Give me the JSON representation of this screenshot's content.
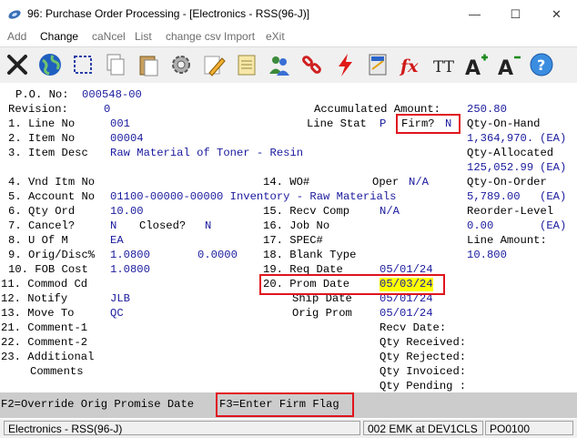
{
  "window": {
    "title": "96: Purchase Order Processing - [Electronics - RSS(96-J)]",
    "minimize_glyph": "—",
    "maximize_glyph": "☐",
    "close_glyph": "✕"
  },
  "menu": [
    {
      "label": "Add"
    },
    {
      "label": "Change"
    },
    {
      "label": "caNcel"
    },
    {
      "label": "List"
    },
    {
      "label": "change csv Import"
    },
    {
      "label": "eXit"
    }
  ],
  "toolbar_icons": [
    "close-x-icon",
    "globe-icon",
    "select-rectangle-icon",
    "copy-icon",
    "paste-icon",
    "settings-icon",
    "edit-pencil-icon",
    "notes-icon",
    "users-icon",
    "link-icon",
    "lightning-icon",
    "calculator-icon",
    "function-icon",
    "font-size-icon",
    "increase-font-icon",
    "decrease-font-icon",
    "help-icon"
  ],
  "toolbar_text": {
    "fx": "fx",
    "tt": "TT",
    "aplus": "A",
    "aminus": "A",
    "help": "?"
  },
  "form": {
    "po_no_label": "P.O. No:",
    "po_no": "000548-00",
    "revision_label": "Revision:",
    "revision": "0",
    "accum_label": "Accumulated Amount:",
    "accum": "250.80",
    "f1_label": "1. Line No",
    "f1": "001",
    "line_stat_label": "Line Stat",
    "line_stat": "P",
    "firm_label": "Firm?",
    "firm": "N",
    "qoh_label": "Qty-On-Hand",
    "qoh": "1,364,970.",
    "qoh_unit": "(EA)",
    "f2_label": "2. Item No",
    "f2": "00004",
    "f3_label": "3. Item Desc",
    "f3": "Raw Material of Toner - Resin",
    "qalloc_label": "Qty-Allocated",
    "qalloc": "125,052.99",
    "qalloc_unit": "(EA)",
    "f4_label": "4. Vnd Itm No",
    "f14_label": "14. WO#",
    "oper_label": "Oper",
    "oper": "N/A",
    "qoo_label": "Qty-On-Order",
    "qoo": "5,789.00",
    "qoo_unit": "(EA)",
    "f5_label": "5. Account No",
    "f5": "01100-00000-00000 Inventory - Raw Materials",
    "f6_label": "6. Qty Ord",
    "f6": "10.00",
    "f15_label": "15. Recv Comp",
    "f15": "N/A",
    "reorder_label": "Reorder-Level",
    "f7_label": "7. Cancel?",
    "f7": "N",
    "closed_label": "Closed?",
    "closed": "N",
    "f16_label": "16. Job No",
    "reorder": "0.00",
    "reorder_unit": "(EA)",
    "f8_label": "8. U Of M",
    "f8": "EA",
    "f17_label": "17. SPEC#",
    "line_amt_label": "Line Amount:",
    "f9_label": "9. Orig/Disc%",
    "f9": "1.0800",
    "f9b": "0.0000",
    "f18_label": "18. Blank Type",
    "line_amt": "10.800",
    "f10_label": "10. FOB Cost",
    "f10": "1.0800",
    "f19_label": "19. Req Date",
    "f19": "05/01/24",
    "f11_label": "11. Commod Cd",
    "f20_label": "20. Prom Date",
    "f20": "05/03/24",
    "f12_label": "12. Notify",
    "f12": "JLB",
    "ship_label": "Ship Date",
    "ship": "05/01/24",
    "f13_label": "13. Move To",
    "f13": "QC",
    "origprom_label": "Orig Prom",
    "origprom": "05/01/24",
    "f21_label": "21. Comment-1",
    "recv_date_label": "Recv Date:",
    "f22_label": "22. Comment-2",
    "qrecv_label": "Qty Received:",
    "f23_label": "23. Additional",
    "qrej_label": "Qty Rejected:",
    "comments_label": "Comments",
    "qinv_label": "Qty Invoiced:",
    "qpend_label": "Qty Pending :"
  },
  "fkeys": {
    "f2": "F2=Override Orig Promise Date",
    "f3": "F3=Enter Firm Flag"
  },
  "status": {
    "company": "Electronics - RSS(96-J)",
    "user": "002 EMK at DEV1CLS",
    "program": "PO0100"
  },
  "colors": {
    "value_text": "#1a1a9e",
    "highlight": "#ffff00",
    "annotation_box": "#e0141e"
  }
}
